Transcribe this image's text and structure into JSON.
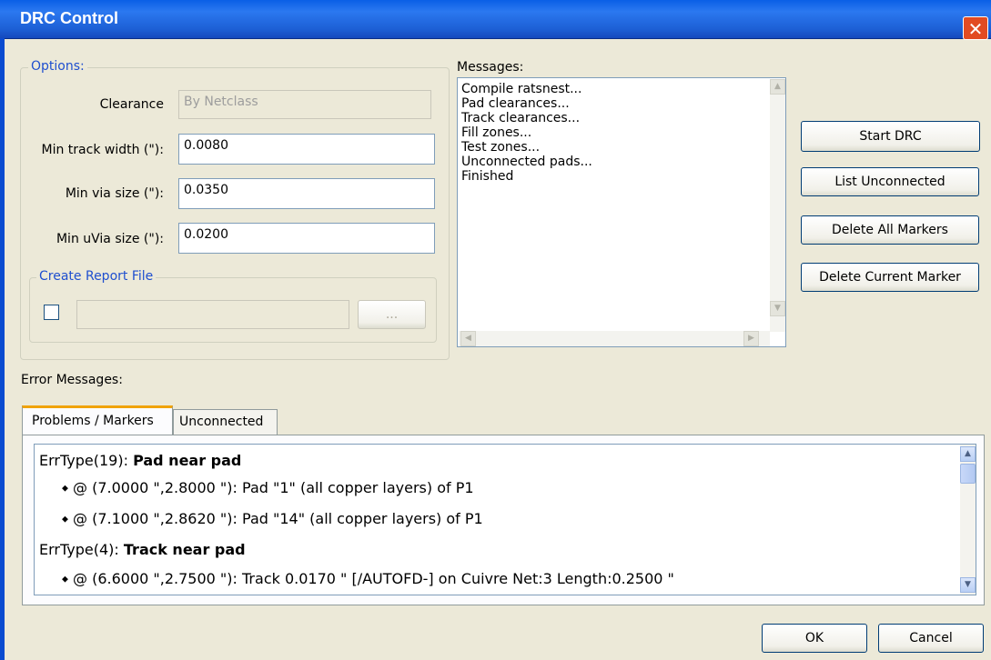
{
  "window": {
    "title": "DRC Control",
    "close_glyph": "✕"
  },
  "options": {
    "legend": "Options:",
    "clearance_label": "Clearance",
    "clearance_value": "By Netclass",
    "min_track_label": "Min track width (\"):",
    "min_track_value": "0.0080",
    "min_via_label": "Min via size (\"):",
    "min_via_value": "0.0350",
    "min_uvia_label": "Min uVia size (\"):",
    "min_uvia_value": "0.0200",
    "report": {
      "legend": "Create Report File",
      "checked": false,
      "path": "",
      "browse_label": "..."
    }
  },
  "messages": {
    "label": "Messages:",
    "lines": [
      "Compile ratsnest...",
      "Pad clearances...",
      "Track clearances...",
      "Fill zones...",
      "Test zones...",
      "Unconnected pads...",
      "Finished"
    ]
  },
  "actions": {
    "start": "Start DRC",
    "list_unconnected": "List Unconnected",
    "delete_all": "Delete All Markers",
    "delete_current": "Delete Current Marker"
  },
  "errors": {
    "label": "Error Messages:",
    "tabs": [
      "Problems / Markers",
      "Unconnected"
    ],
    "active_tab": 0,
    "entries": [
      {
        "type": "ErrType(19):",
        "title": "Pad near pad"
      },
      {
        "item": "@ (7.0000 \",2.8000 \"): Pad \"1\" (all copper layers) of P1"
      },
      {
        "item": "@ (7.1000 \",2.8620 \"): Pad \"14\" (all copper layers) of P1"
      },
      {
        "type": "ErrType(4):",
        "title": "Track near pad"
      },
      {
        "item": "@ (6.6000 \",2.7500 \"): Track 0.0170 \" [/AUTOFD-] on Cuivre Net:3 Length:0.2500 \""
      }
    ],
    "bullet": "◆"
  },
  "footer": {
    "ok": "OK",
    "cancel": "Cancel"
  },
  "icons": {
    "scroll_up": "triangle-up-icon",
    "scroll_down": "triangle-down-icon",
    "scroll_left": "triangle-left-icon",
    "scroll_right": "triangle-right-icon"
  }
}
